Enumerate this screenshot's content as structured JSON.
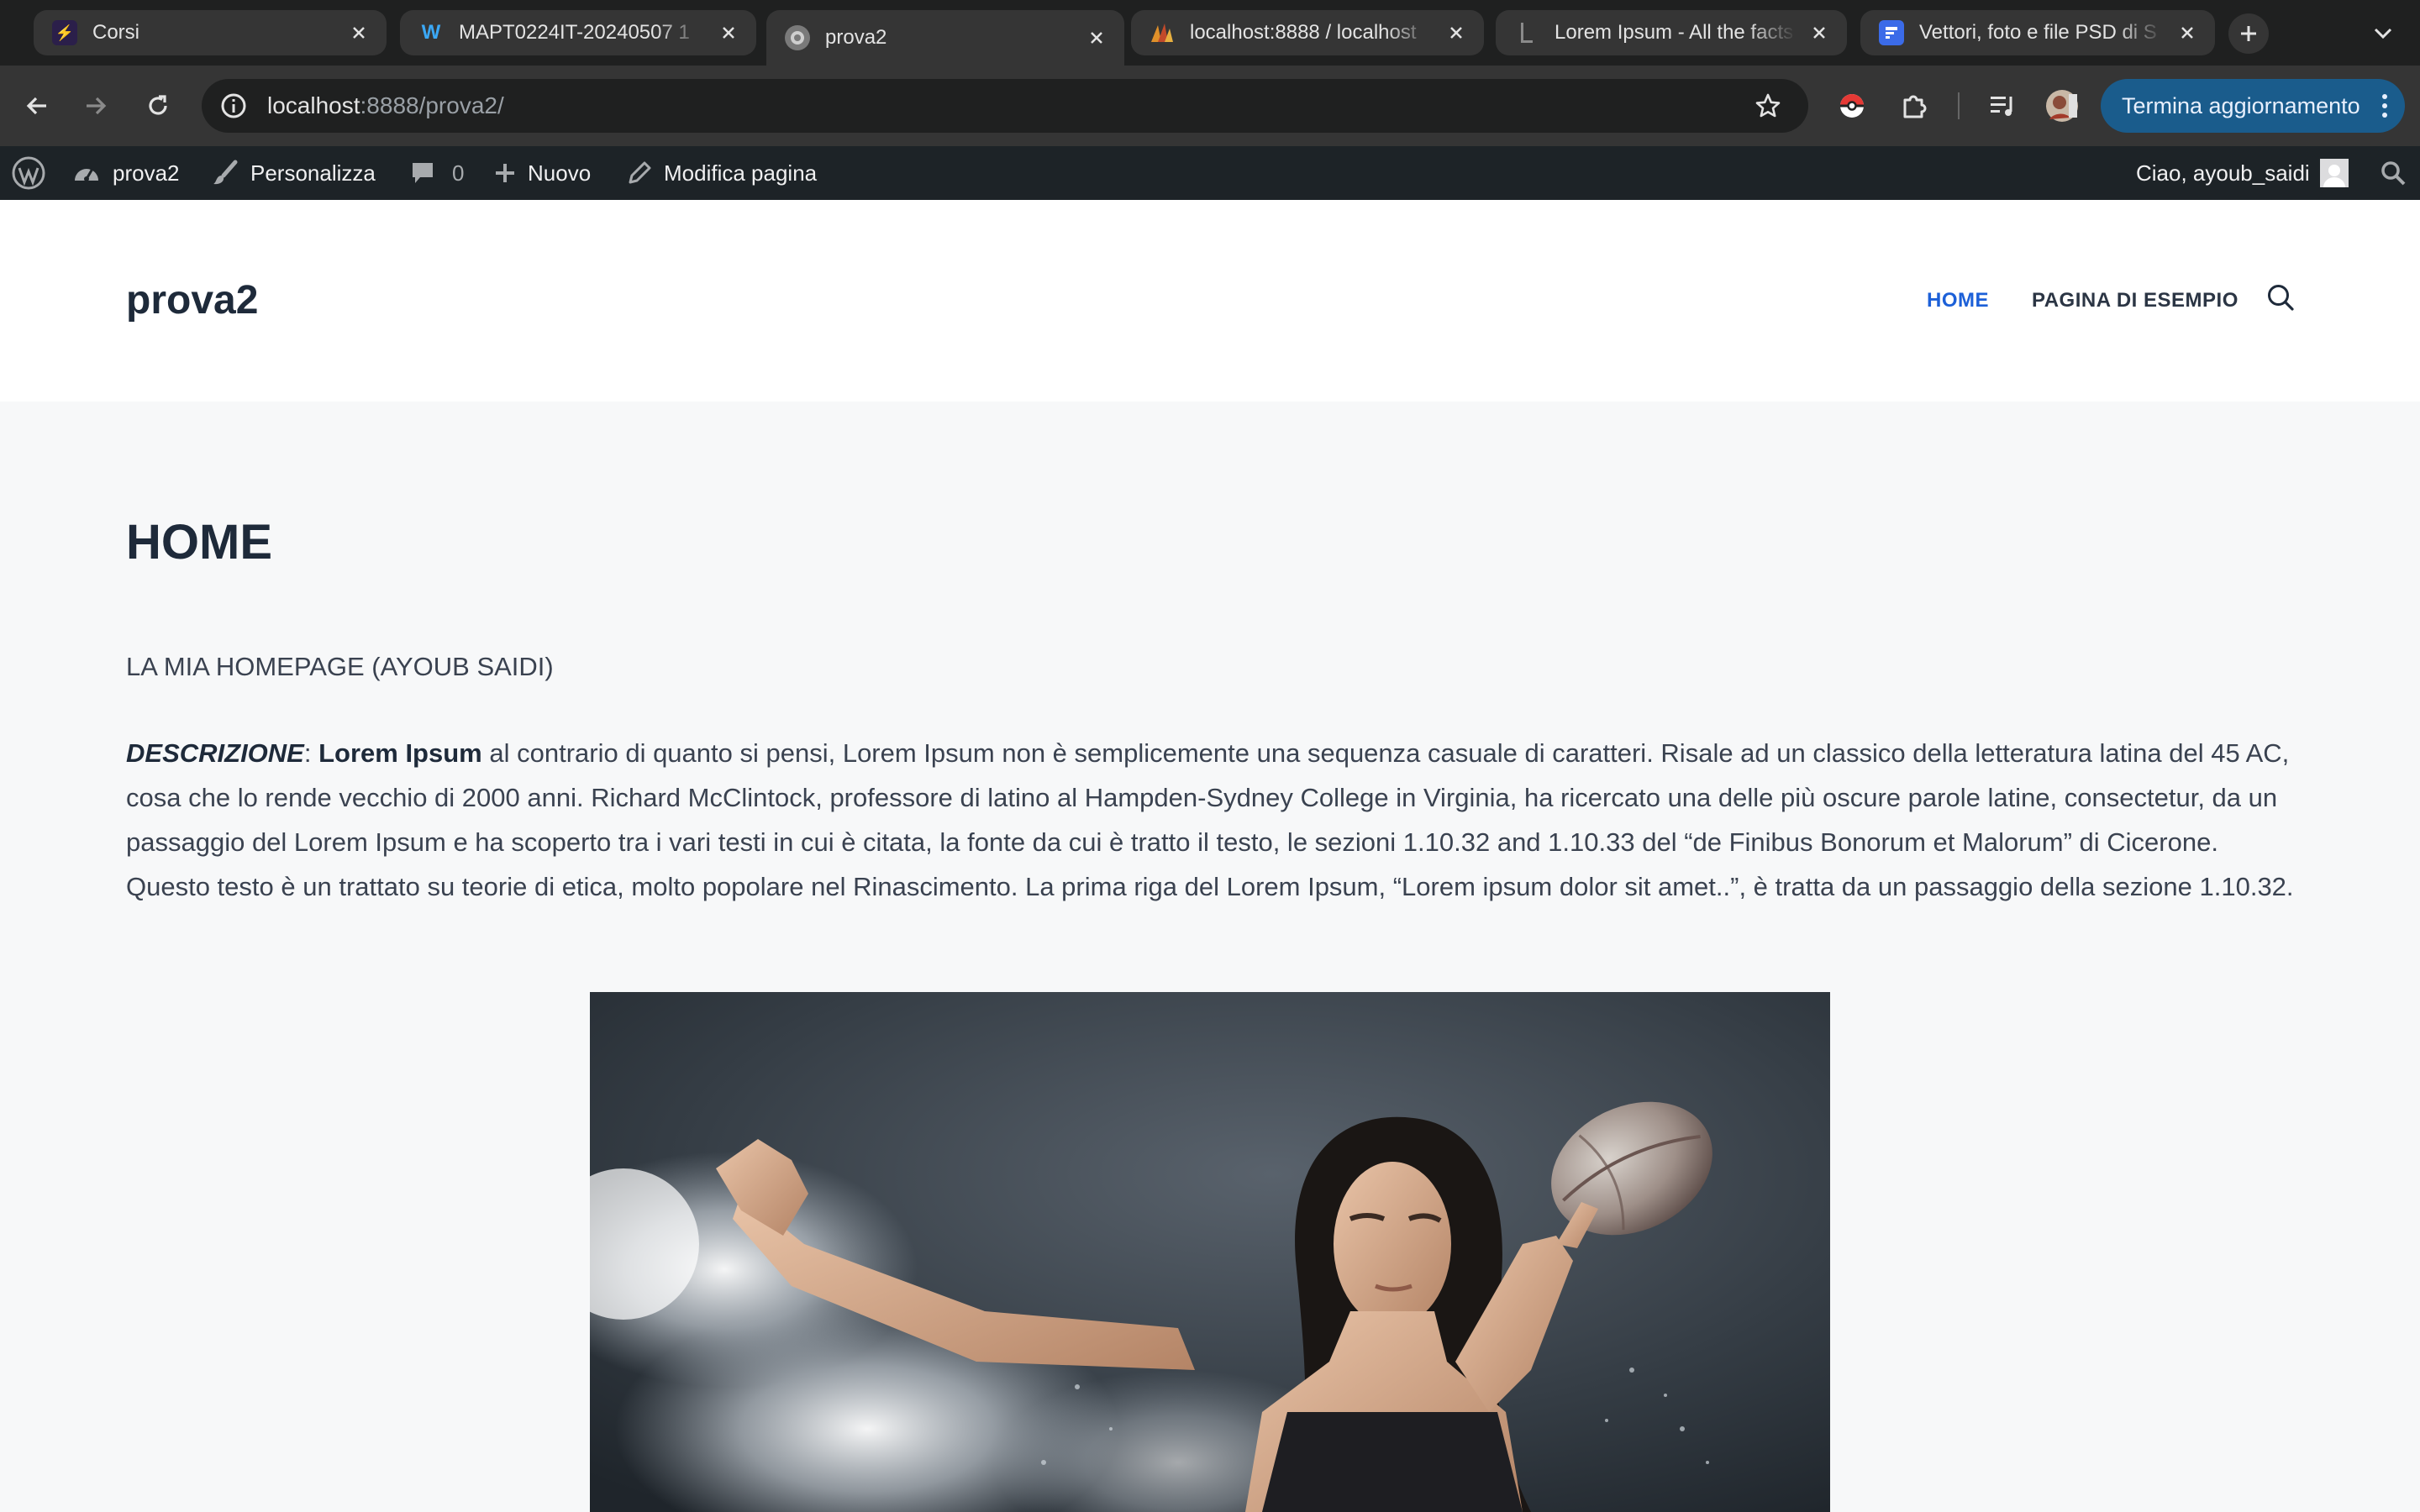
{
  "tabs": [
    {
      "label": "Corsi",
      "favicon_color": "#2b1f4a",
      "favicon_glyph": "⚡"
    },
    {
      "label": "MAPT0224IT-20240507 1",
      "favicon_color": "#1e88e5",
      "favicon_glyph": "W"
    },
    {
      "label": "prova2",
      "favicon_color": "#6b6b6b",
      "favicon_glyph": "◉"
    },
    {
      "label": "localhost:8888 / localhost",
      "favicon_color": "#c77a2a",
      "favicon_glyph": "▲"
    },
    {
      "label": "Lorem Ipsum - All the facts",
      "favicon_color": "#222222",
      "favicon_glyph": "L"
    },
    {
      "label": "Vettori, foto e file PSD di S",
      "favicon_color": "#3b6be8",
      "favicon_glyph": "F"
    }
  ],
  "address": {
    "host": "localhost",
    "rest": ":8888/prova2/"
  },
  "update_button": "Termina aggiornamento",
  "adminbar": {
    "site": "prova2",
    "customize": "Personalizza",
    "comments_count": "0",
    "new": "Nuovo",
    "edit": "Modifica pagina",
    "greeting": "Ciao, ayoub_saidi"
  },
  "site": {
    "title": "prova2",
    "nav": [
      "HOME",
      "PAGINA DI ESEMPIO"
    ]
  },
  "page": {
    "title": "HOME",
    "subtitle": "LA MIA HOMEPAGE (AYOUB SAIDI)",
    "desc_label": "DESCRIZIONE",
    "desc_colon": ": ",
    "desc_bold": "Lorem Ipsum",
    "desc_body": " al contrario di quanto si pensi, Lorem Ipsum non è semplicemente una sequenza casuale di caratteri. Risale ad un classico della letteratura latina del 45 AC, cosa che lo rende vecchio di 2000 anni. Richard McClintock, professore di latino al Hampden-Sydney College in Virginia, ha ricercato una delle più oscure parole latine, consectetur, da un passaggio del Lorem Ipsum e ha scoperto tra i vari testi in cui è citata, la fonte da cui è tratto il testo, le sezioni 1.10.32 and 1.10.33 del “de Finibus Bonorum et Malorum” di Cicerone. Questo testo è un trattato su teorie di etica, molto popolare nel Rinascimento. La prima riga del Lorem Ipsum, “Lorem ipsum dolor sit amet..”, è tratta da un passaggio della sezione 1.10.32."
  },
  "colors": {
    "accent": "#1c60d8",
    "adminbar": "#1d2327",
    "heading": "#1e2a3a",
    "text": "#3a4250"
  }
}
